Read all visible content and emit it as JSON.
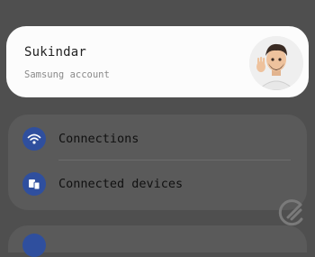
{
  "account": {
    "name": "Sukindar",
    "subtitle": "Samsung account",
    "avatar_icon": "avatar-memoji"
  },
  "settings": {
    "items": [
      {
        "label": "Connections",
        "icon": "wifi-icon"
      },
      {
        "label": "Connected devices",
        "icon": "connected-devices-icon"
      }
    ]
  },
  "colors": {
    "background": "#4f4f4f",
    "card": "#fcfcfc",
    "icon_accent": "#2f4f9e"
  }
}
